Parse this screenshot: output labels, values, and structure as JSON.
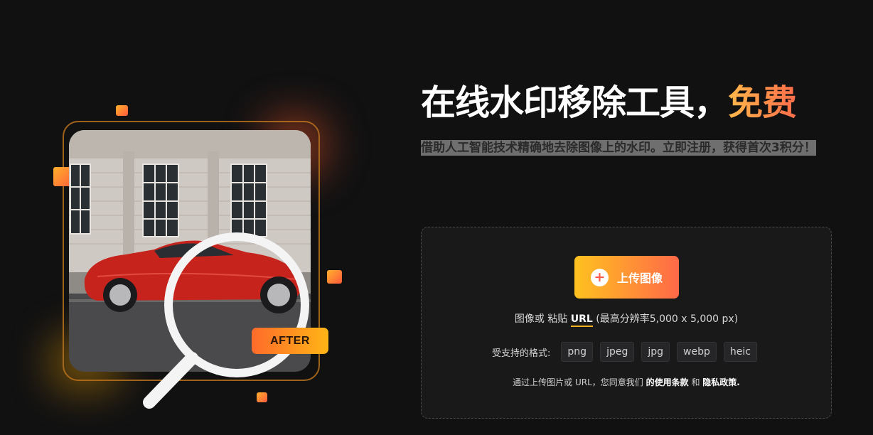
{
  "hero": {
    "title_main": "在线水印移除工具，",
    "title_highlight": "免费",
    "subtitle": "借助人工智能技术精确地去除图像上的水印。立即注册，获得首次3积分！"
  },
  "illustration": {
    "after_badge": "AFTER"
  },
  "upload": {
    "button_label": "上传图像",
    "paste_prefix": "图像或 粘贴",
    "paste_url": "URL",
    "paste_suffix": "(最高分辨率5,000 x 5,000 px)",
    "formats_label": "受支持的格式:",
    "formats": [
      "png",
      "jpeg",
      "jpg",
      "webp",
      "heic"
    ],
    "terms_prefix": "通过上传图片或 URL，您同意我们",
    "terms_link": "的使用条款",
    "terms_and": "和",
    "privacy_link": "隐私政策."
  },
  "colors": {
    "background": "#111112",
    "accent_orange": "#ff6948",
    "accent_yellow": "#ffc21f"
  }
}
